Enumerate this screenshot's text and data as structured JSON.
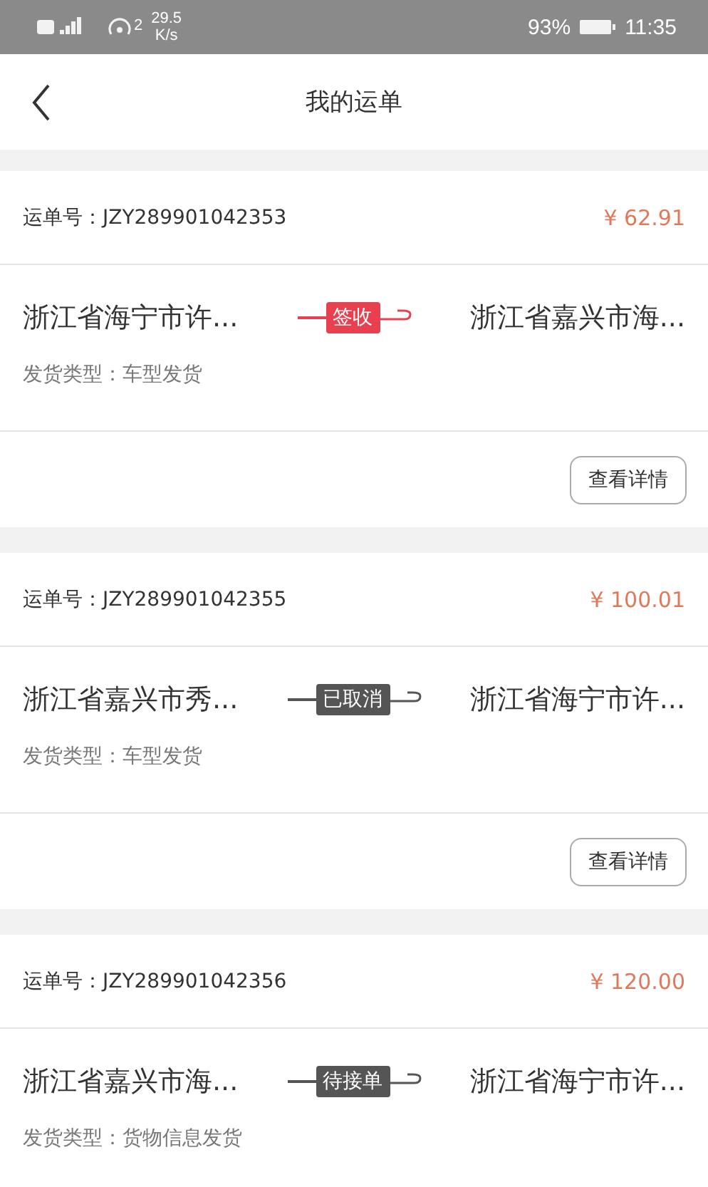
{
  "status_bar": {
    "speed_superscript": "2",
    "speed": "29.5",
    "speed_unit": "K/s",
    "battery": "93%",
    "time": "11:35"
  },
  "header": {
    "title": "我的运单"
  },
  "orders": [
    {
      "number_label": "运单号：",
      "number": "JZY289901042353",
      "price": "¥ 62.91",
      "from": "浙江省海宁市许...",
      "to": "浙江省嘉兴市海...",
      "status": "签收",
      "color": "#e8404f",
      "type": "发货类型：车型发货",
      "button": "查看详情"
    },
    {
      "number_label": "运单号：",
      "number": "JZY289901042355",
      "price": "¥ 100.01",
      "from": "浙江省嘉兴市秀...",
      "to": "浙江省海宁市许...",
      "status": "已取消",
      "color": "#555555",
      "type": "发货类型：车型发货",
      "button": "查看详情"
    },
    {
      "number_label": "运单号：",
      "number": "JZY289901042356",
      "price": "¥ 120.00",
      "from": "浙江省嘉兴市海...",
      "to": "浙江省海宁市许...",
      "status": "待接单",
      "color": "#555555",
      "type": "发货类型：货物信息发货"
    }
  ]
}
